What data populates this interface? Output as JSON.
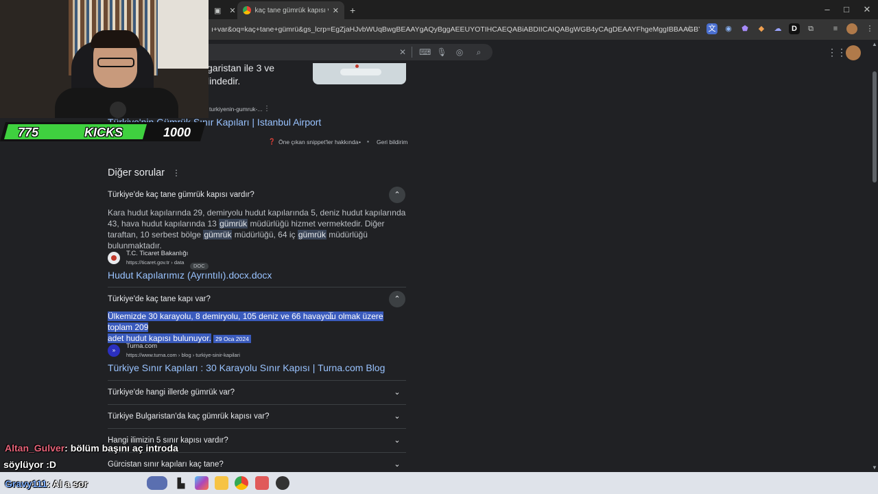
{
  "browser": {
    "tabs": [
      {
        "title": "",
        "icon": "window-icon"
      },
      {
        "title": "kaç tane gümrük kapısı var - Google'da Ara",
        "icon": "google-chrome-icon"
      }
    ],
    "new_tab": "+",
    "url": "ı+var&oq=kaç+tane+gümrü&gs_lcrp=EgZjaHJvbWUqBwgBEAAYgAQyBggAEEUYOTIHCAEQABiABDIICAIQABgWGB4yCAgDEAAYFhgeMggIBBAAGBYYHjIICAUQABg...",
    "window_controls": [
      "–",
      "□",
      "✕"
    ]
  },
  "featured_snippet": {
    "text_line1": "garistan ile 3 ve",
    "text_line2": "lindedir.",
    "source_url": "turkiyenin-gumruk-...",
    "title": "Türkiye'nin Gümrük Sınır Kapıları | Istanbul Airport",
    "about_label": "Öne çıkan snippet'ler hakkında",
    "separator": "•",
    "feedback_label": "Geri bildirim"
  },
  "other_questions": {
    "heading": "Diğer sorular",
    "items": [
      {
        "question": "Türkiye'de kaç tane gümrük kapısı vardır?",
        "expanded": true,
        "answer_parts": [
          "Kara hudut kapılarında 29, demiryolu hudut kapılarında 5, deniz hudut kapılarında 43, hava hudut kapılarında 13 ",
          "gümrük",
          " müdürlüğü hizmet vermektedir. Diğer taraftan, 10 serbest bölge ",
          "gümrük",
          " müdürlüğü, 64 iç ",
          "gümrük",
          " müdürlüğü bulunmaktadır."
        ],
        "source_name": "T.C. Ticaret Bakanlığı",
        "source_url": "https://ticaret.gov.tr › data",
        "badge": "DOC",
        "link_title": "Hudut Kapılarımız (Ayrıntılı).docx.docx"
      },
      {
        "question": "Türkiye'de kaç tane kapı var?",
        "expanded": true,
        "answer_line1": "Ülkemizde 30 karayolu, 8 demiryolu, 105 deniz ve 66 havayolu olmak üzere toplam 209",
        "answer_line2": "adet hudut kapısı bulunuyor.",
        "date": "29 Oca 2024",
        "source_name": "Turna.com",
        "source_url": "https://www.turna.com › blog › turkiye-sinir-kapilari",
        "link_title": "Türkiye Sınır Kapıları : 30 Karayolu Sınır Kapısı | Turna.com Blog"
      },
      {
        "question": "Türkiye'de hangi illerde gümrük var?",
        "expanded": false
      },
      {
        "question": "Türkiye Bulgaristan'da kaç gümrük kapısı var?",
        "expanded": false
      },
      {
        "question": "Hangi ilimizin 5 sınır kapısı vardır?",
        "expanded": false
      },
      {
        "question": "Gürcistan sınır kapıları kaç tane?",
        "expanded": false
      }
    ]
  },
  "stream_overlay": {
    "hud_left": "775",
    "hud_mid": "KICKS",
    "hud_right": "1000",
    "chat": [
      {
        "user": "Altan_Gulver",
        "user_color": "#e8647a",
        "message": ": bölüm başını aç introda"
      },
      {
        "user": "",
        "message": "söylüyor :D"
      },
      {
        "user": "Gravy111",
        "user_color": "#7fb0ff",
        "message": ": Al a sor"
      }
    ]
  },
  "colors": {
    "accent_link": "#99c3ff",
    "selection": "#3a5bbd",
    "hud_green": "#3fd13f"
  }
}
